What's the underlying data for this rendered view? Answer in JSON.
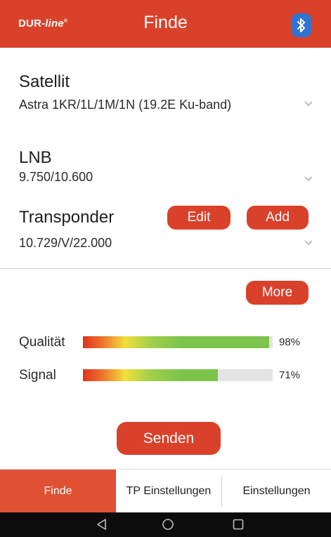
{
  "header": {
    "brand_prefix": "DUR-",
    "brand_suffix": "line",
    "brand_mark": "®",
    "title": "Finde",
    "bluetooth_icon": "bluetooth-icon",
    "accent_color": "#d9412a"
  },
  "satellite": {
    "label": "Satellit",
    "value": "Astra 1KR/1L/1M/1N (19.2E Ku-band)"
  },
  "lnb": {
    "label": "LNB",
    "value": "9.750/10.600"
  },
  "transponder": {
    "label": "Transponder",
    "value": "10.729/V/22.000",
    "edit_label": "Edit",
    "add_label": "Add"
  },
  "more_label": "More",
  "meters": {
    "quality": {
      "label": "Qualität",
      "percent_text": "98%",
      "value": 0.98
    },
    "signal": {
      "label": "Signal",
      "percent_text": "71%",
      "value": 0.71
    }
  },
  "send_label": "Senden",
  "tabs": [
    {
      "label": "Finde",
      "active": true
    },
    {
      "label": "TP Einstellungen",
      "active": false
    },
    {
      "label": "Einstellungen",
      "active": false
    }
  ],
  "navbar": {
    "back_icon": "back-triangle-icon",
    "home_icon": "home-circle-icon",
    "recents_icon": "recents-square-icon"
  }
}
